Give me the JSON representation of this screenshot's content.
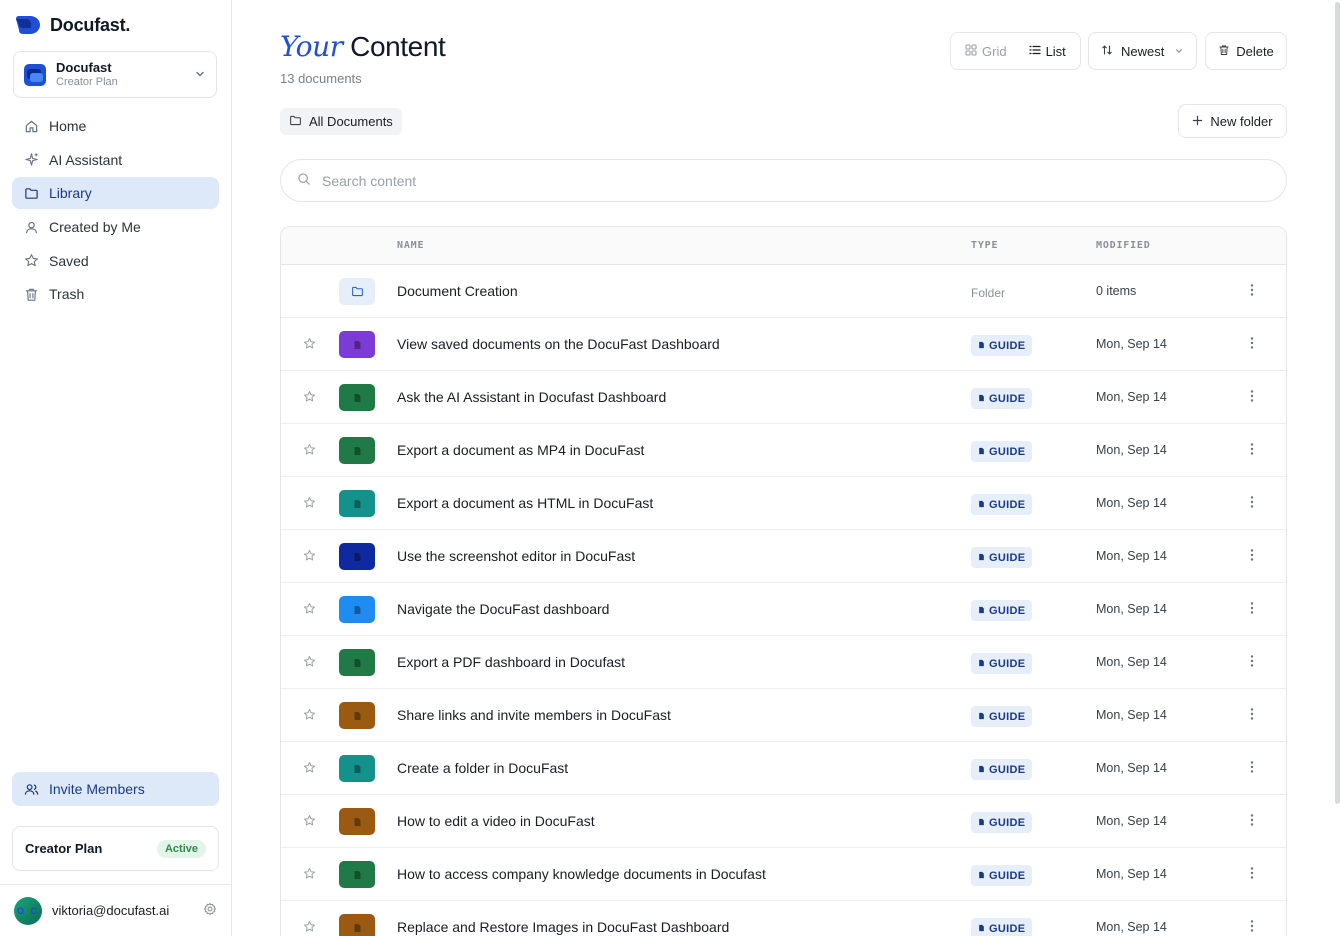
{
  "brand": {
    "name": "Docufast."
  },
  "workspace": {
    "name": "Docufast",
    "plan": "Creator Plan"
  },
  "nav": [
    {
      "label": "Home",
      "icon": "home-icon",
      "active": false
    },
    {
      "label": "AI Assistant",
      "icon": "sparkle-icon",
      "active": false
    },
    {
      "label": "Library",
      "icon": "folder-icon",
      "active": true
    },
    {
      "label": "Created by Me",
      "icon": "user-icon",
      "active": false
    },
    {
      "label": "Saved",
      "icon": "star-icon",
      "active": false
    },
    {
      "label": "Trash",
      "icon": "trash-icon",
      "active": false
    }
  ],
  "invite": {
    "label": "Invite Members"
  },
  "plan_card": {
    "name": "Creator Plan",
    "status": "Active"
  },
  "user": {
    "email": "viktoria@docufast.ai",
    "initials": "O C"
  },
  "header": {
    "title_accent": "Your",
    "title_rest": "Content",
    "count": "13 documents"
  },
  "toolbar": {
    "grid_label": "Grid",
    "list_label": "List",
    "sort_label": "Newest",
    "delete_label": "Delete",
    "new_folder_label": "New folder"
  },
  "breadcrumb": {
    "label": "All Documents"
  },
  "search": {
    "placeholder": "Search content"
  },
  "table": {
    "columns": {
      "name": "NAME",
      "type": "TYPE",
      "modified": "MODIFIED"
    },
    "rows": [
      {
        "name": "Document Creation",
        "type": "Folder",
        "modified": "0 items",
        "thumb": "#e6eef9",
        "kind": "folder"
      },
      {
        "name": "View saved documents on the DocuFast Dashboard",
        "type": "GUIDE",
        "modified": "Mon, Sep 14",
        "thumb": "#7c3ad6",
        "kind": "doc"
      },
      {
        "name": "Ask the AI Assistant in Docufast Dashboard",
        "type": "GUIDE",
        "modified": "Mon, Sep 14",
        "thumb": "#1f7a45",
        "kind": "doc"
      },
      {
        "name": "Export a document as MP4 in DocuFast",
        "type": "GUIDE",
        "modified": "Mon, Sep 14",
        "thumb": "#1f7a45",
        "kind": "doc"
      },
      {
        "name": "Export a document as HTML in DocuFast",
        "type": "GUIDE",
        "modified": "Mon, Sep 14",
        "thumb": "#14918a",
        "kind": "doc"
      },
      {
        "name": "Use the screenshot editor in DocuFast",
        "type": "GUIDE",
        "modified": "Mon, Sep 14",
        "thumb": "#0f2a9e",
        "kind": "doc"
      },
      {
        "name": "Navigate the DocuFast dashboard",
        "type": "GUIDE",
        "modified": "Mon, Sep 14",
        "thumb": "#1e8cf0",
        "kind": "doc"
      },
      {
        "name": "Export a PDF dashboard in Docufast",
        "type": "GUIDE",
        "modified": "Mon, Sep 14",
        "thumb": "#1f7a45",
        "kind": "doc"
      },
      {
        "name": "Share links and invite members in DocuFast",
        "type": "GUIDE",
        "modified": "Mon, Sep 14",
        "thumb": "#9a5a12",
        "kind": "doc"
      },
      {
        "name": "Create a folder in DocuFast",
        "type": "GUIDE",
        "modified": "Mon, Sep 14",
        "thumb": "#14918a",
        "kind": "doc"
      },
      {
        "name": "How to edit a video in DocuFast",
        "type": "GUIDE",
        "modified": "Mon, Sep 14",
        "thumb": "#9a5a12",
        "kind": "doc"
      },
      {
        "name": "How to access company knowledge documents in Docufast",
        "type": "GUIDE",
        "modified": "Mon, Sep 14",
        "thumb": "#1f7a45",
        "kind": "doc"
      },
      {
        "name": "Replace and Restore Images in DocuFast Dashboard",
        "type": "GUIDE",
        "modified": "Mon, Sep 14",
        "thumb": "#9a5a12",
        "kind": "doc"
      }
    ]
  },
  "colors": {
    "accent": "#1f4fd6",
    "active_bg": "#dde8f8",
    "badge_bg": "#e6eef9",
    "active_status": "#2f8a4d"
  }
}
